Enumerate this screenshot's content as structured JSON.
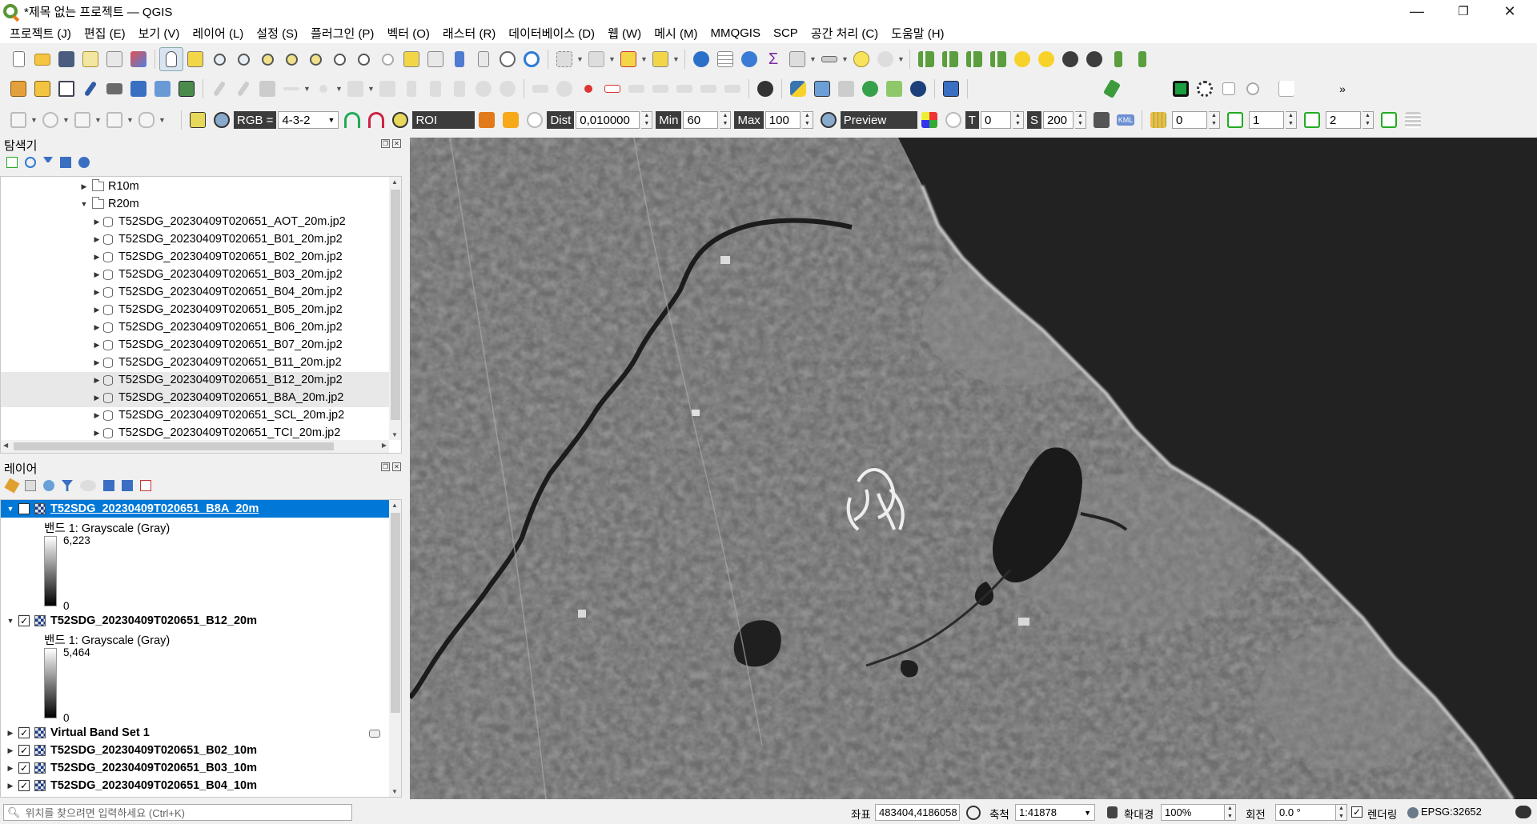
{
  "title": "*제목 없는 프로젝트 — QGIS",
  "window_controls": {
    "minimize": "—",
    "maximize": "❐",
    "close": "✕"
  },
  "menu": [
    "프로젝트 (J)",
    "편집 (E)",
    "보기 (V)",
    "레이어 (L)",
    "설정 (S)",
    "플러그인 (P)",
    "벡터 (O)",
    "래스터 (R)",
    "데이터베이스 (D)",
    "웹 (W)",
    "메시 (M)",
    "MMQGIS",
    "SCP",
    "공간 처리 (C)",
    "도움말 (H)"
  ],
  "scp_toolbar": {
    "rgb_label": "RGB =",
    "rgb_value": "4-3-2",
    "roi_label": "ROI",
    "dist_label": "Dist",
    "dist_value": "0,010000",
    "min_label": "Min",
    "min_value": "60",
    "max_label": "Max",
    "max_value": "100",
    "preview_label": "Preview",
    "t_label": "T",
    "t_value": "0",
    "s_label": "S",
    "s_value": "200",
    "kml_label": "KML",
    "band1_value": "0",
    "band2_value": "1",
    "band3_value": "2"
  },
  "browser": {
    "title": "탐색기",
    "items": [
      {
        "label": "R10m",
        "type": "folder",
        "expanded": false
      },
      {
        "label": "R20m",
        "type": "folder",
        "expanded": true
      },
      {
        "label": "T52SDG_20230409T020651_AOT_20m.jp2",
        "type": "file"
      },
      {
        "label": "T52SDG_20230409T020651_B01_20m.jp2",
        "type": "file"
      },
      {
        "label": "T52SDG_20230409T020651_B02_20m.jp2",
        "type": "file"
      },
      {
        "label": "T52SDG_20230409T020651_B03_20m.jp2",
        "type": "file"
      },
      {
        "label": "T52SDG_20230409T020651_B04_20m.jp2",
        "type": "file"
      },
      {
        "label": "T52SDG_20230409T020651_B05_20m.jp2",
        "type": "file"
      },
      {
        "label": "T52SDG_20230409T020651_B06_20m.jp2",
        "type": "file"
      },
      {
        "label": "T52SDG_20230409T020651_B07_20m.jp2",
        "type": "file"
      },
      {
        "label": "T52SDG_20230409T020651_B11_20m.jp2",
        "type": "file"
      },
      {
        "label": "T52SDG_20230409T020651_B12_20m.jp2",
        "type": "file"
      },
      {
        "label": "T52SDG_20230409T020651_B8A_20m.jp2",
        "type": "file"
      },
      {
        "label": "T52SDG_20230409T020651_SCL_20m.jp2",
        "type": "file"
      },
      {
        "label": "T52SDG_20230409T020651_TCI_20m.jp2",
        "type": "file"
      }
    ]
  },
  "layers": {
    "title": "레이어",
    "items": [
      {
        "name": "T52SDG_20230409T020651_B8A_20m",
        "selected": true,
        "checked": true,
        "band": "밴드 1: Grayscale (Gray)",
        "max": "6,223",
        "min": "0"
      },
      {
        "name": "T52SDG_20230409T020651_B12_20m",
        "selected": false,
        "checked": true,
        "band": "밴드 1: Grayscale (Gray)",
        "max": "5,464",
        "min": "0"
      },
      {
        "name": "Virtual Band Set 1",
        "checked": true
      },
      {
        "name": "T52SDG_20230409T020651_B02_10m",
        "checked": true
      },
      {
        "name": "T52SDG_20230409T020651_B03_10m",
        "checked": true
      },
      {
        "name": "T52SDG_20230409T020651_B04_10m",
        "checked": true
      }
    ]
  },
  "status": {
    "search_placeholder": "위치를 찾으려면 입력하세요 (Ctrl+K)",
    "coord_label": "좌표",
    "coord_value": "483404,4186058",
    "scale_label": "축척",
    "scale_value": "1:41878",
    "magnifier_label": "확대경",
    "magnifier_value": "100%",
    "rotation_label": "회전",
    "rotation_value": "0.0 °",
    "render_label": "렌더링",
    "crs": "EPSG:32652"
  },
  "colors": {
    "selection": "#0078d7",
    "scp_label_bg": "#3c3c3c",
    "sea": "#1e1e1e",
    "land": "#6b6b6b"
  }
}
